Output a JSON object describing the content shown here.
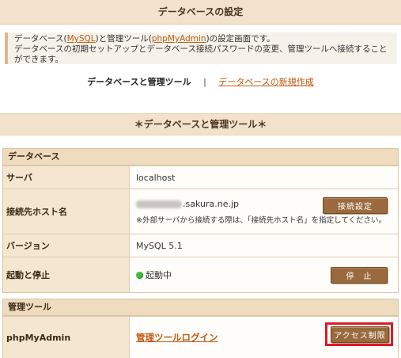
{
  "header": {
    "title": "データベースの設定"
  },
  "description": {
    "line1_prefix": "データベース(",
    "mysql_link": "MySQL",
    "line1_mid": ")と管理ツール(",
    "pma_link": "phpMyAdmin",
    "line1_suffix": ")の設定画面です。",
    "line2": "データベースの初期セットアップとデータベース接続パスワードの変更、管理ツールへ接続することができます。"
  },
  "tabs": {
    "active": "データベースと管理ツール",
    "separator": "|",
    "new_db": "データベースの新規作成"
  },
  "section": {
    "title": "＊データベースと管理ツール＊"
  },
  "database_panel": {
    "title": "データベース",
    "server_label": "サーバ",
    "server_value": "localhost",
    "host_label": "接続先ホスト名",
    "host_value": ".sakura.ne.jp",
    "host_note": "※外部サーバから接続する際は、「接続先ホスト名」を指定してください。",
    "host_button": "接続設定",
    "version_label": "バージョン",
    "version_value": "MySQL 5.1",
    "status_label": "起動と停止",
    "status_value": "起動中",
    "stop_button": "停　止"
  },
  "tools_panel": {
    "title": "管理ツール",
    "pma_label": "phpMyAdmin",
    "login_link": "管理ツールログイン",
    "access_button": "アクセス制限"
  },
  "colors": {
    "accent_link": "#c05a10",
    "button": "#9a6a3e",
    "highlight": "#e0182a",
    "running": "#3fbf3f"
  }
}
